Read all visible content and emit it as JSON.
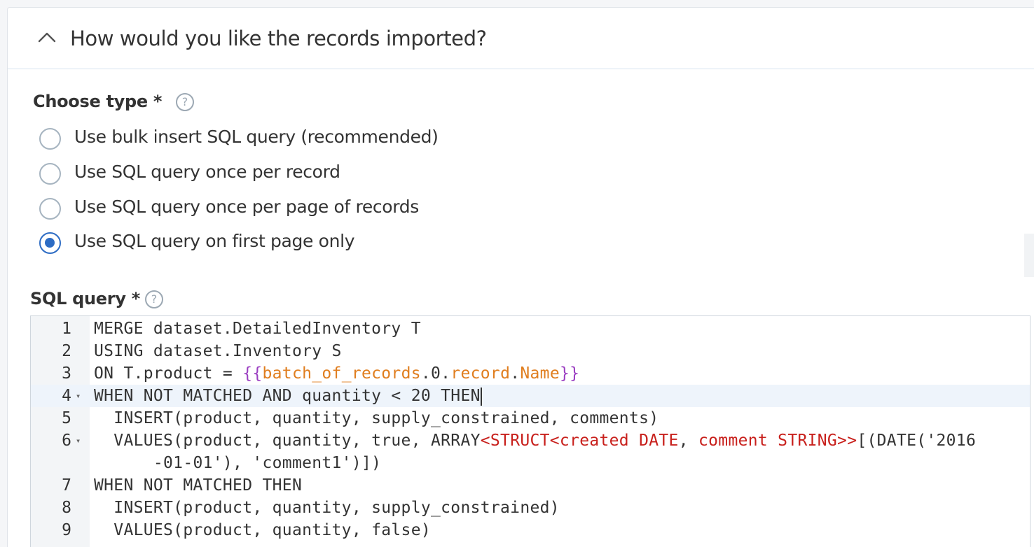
{
  "section": {
    "title": "How would you like the records imported?"
  },
  "choose_type": {
    "label": "Choose type *",
    "help": "?",
    "options": [
      {
        "label": "Use bulk insert SQL query (recommended)",
        "selected": false
      },
      {
        "label": "Use SQL query once per record",
        "selected": false
      },
      {
        "label": "Use SQL query once per page of records",
        "selected": false
      },
      {
        "label": "Use SQL query on first page only",
        "selected": true
      }
    ]
  },
  "sql_query": {
    "label": "SQL query *",
    "help": "?",
    "lines": [
      {
        "n": "1",
        "fold": "",
        "text": "MERGE dataset.DetailedInventory T"
      },
      {
        "n": "2",
        "fold": "",
        "text": "USING dataset.Inventory S"
      },
      {
        "n": "3",
        "fold": "",
        "text": "ON T.product = {{batch_of_records.0.record.Name}}"
      },
      {
        "n": "4",
        "fold": "▾",
        "text": "WHEN NOT MATCHED AND quantity < 20 THEN"
      },
      {
        "n": "5",
        "fold": "",
        "text": "  INSERT(product, quantity, supply_constrained, comments)"
      },
      {
        "n": "6",
        "fold": "▾",
        "text": "  VALUES(product, quantity, true, ARRAY<STRUCT<created DATE, comment STRING>>[(DATE('2016"
      },
      {
        "n": "",
        "fold": "",
        "text": "      -01-01'), 'comment1')])"
      },
      {
        "n": "7",
        "fold": "",
        "text": "WHEN NOT MATCHED THEN"
      },
      {
        "n": "8",
        "fold": "",
        "text": "  INSERT(product, quantity, supply_constrained)"
      },
      {
        "n": "9",
        "fold": "",
        "text": "  VALUES(product, quantity, false)"
      }
    ],
    "colors": {
      "brace": "#9b3fc1",
      "variable": "#e07e1f",
      "type": "#c8201c"
    }
  }
}
